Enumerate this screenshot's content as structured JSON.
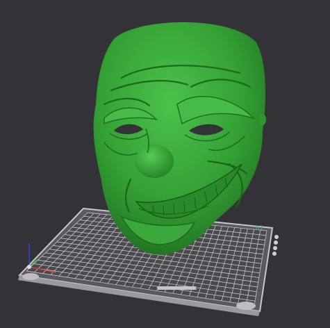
{
  "viewport": {
    "background": "#333337"
  },
  "model": {
    "color": "#3a9e3a"
  },
  "build_plate": {
    "label": "01",
    "frame_color": "#b8b8bc",
    "grid_color": "#d8d8dc"
  },
  "axes": {
    "x_color": "#d23c3c",
    "y_color": "#3cbe3c",
    "z_color": "#3c3cdc"
  },
  "icons": {
    "axis_gizmo": "axis-gizmo-icon"
  }
}
